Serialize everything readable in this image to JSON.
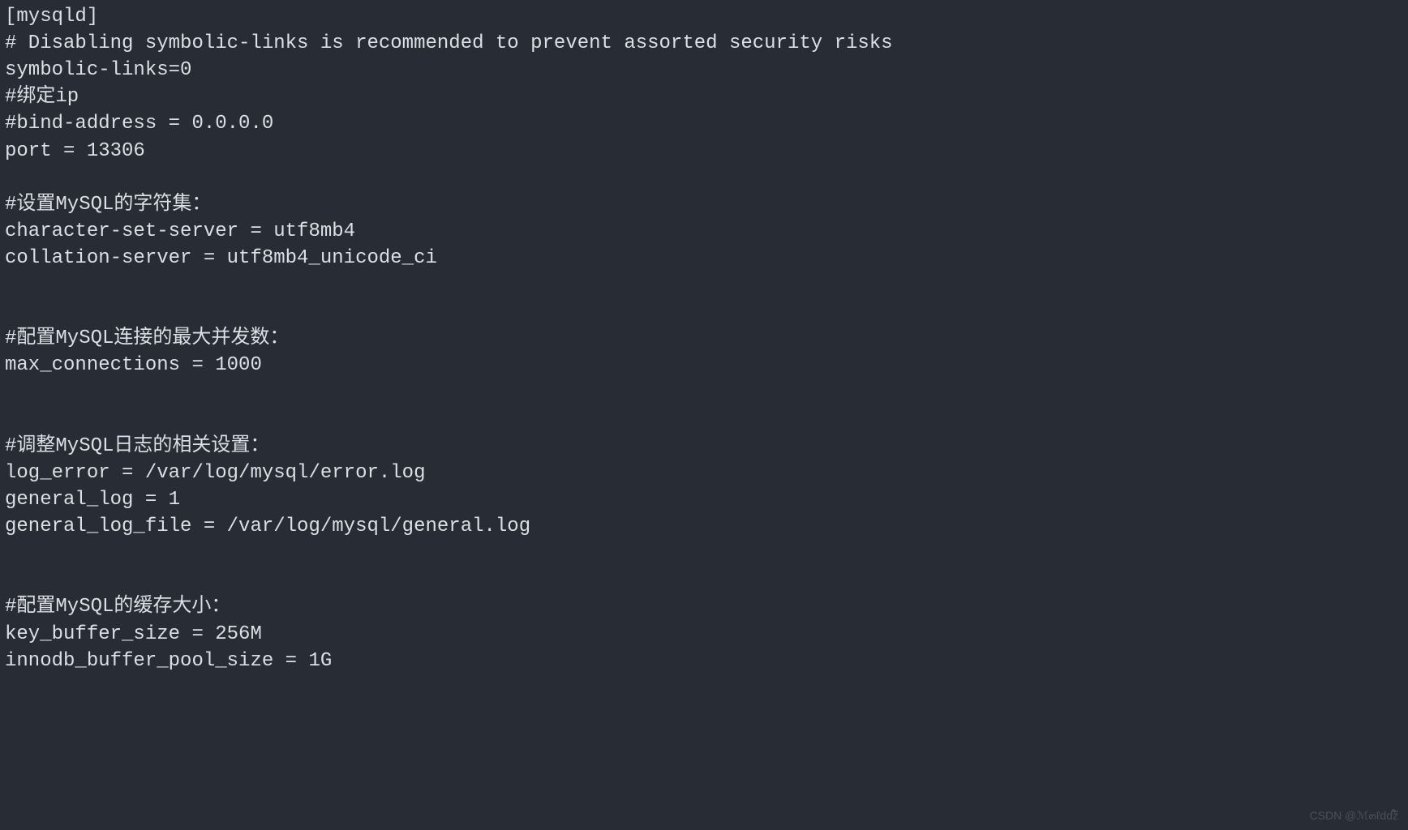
{
  "config": {
    "lines": [
      "[mysqld]",
      "# Disabling symbolic-links is recommended to prevent assorted security risks",
      "symbolic-links=0",
      "#绑定ip",
      "#bind-address = 0.0.0.0",
      "port = 13306",
      "",
      "#设置MySQL的字符集：",
      "character-set-server = utf8mb4",
      "collation-server = utf8mb4_unicode_ci",
      "",
      "",
      "#配置MySQL连接的最大并发数：",
      "max_connections = 1000",
      "",
      "",
      "#调整MySQL日志的相关设置：",
      "log_error = /var/log/mysql/error.log",
      "general_log = 1",
      "general_log_file = /var/log/mysql/general.log",
      "",
      "",
      "#配置MySQL的缓存大小：",
      "key_buffer_size = 256M",
      "innodb_buffer_pool_size = 1G"
    ]
  },
  "watermark": "CSDN @ℳ๓ℓddz໌໋"
}
